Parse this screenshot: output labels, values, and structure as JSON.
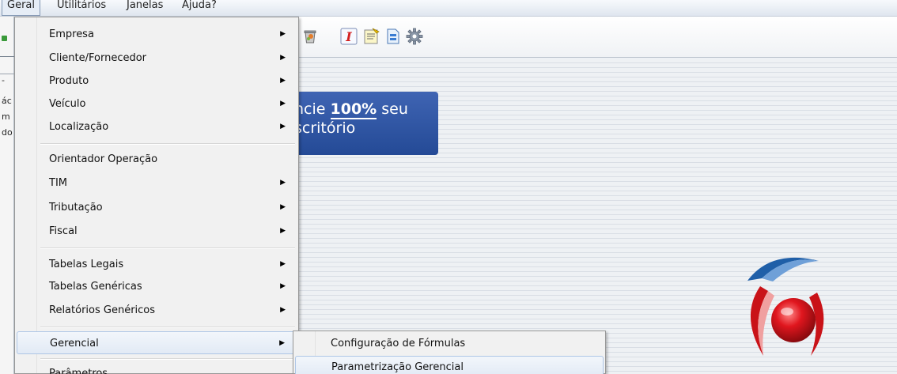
{
  "menubar": {
    "items": [
      "Geral",
      "Utilitários",
      "Janelas",
      "Ajuda?"
    ]
  },
  "left_strip": {
    "fragments": [
      "-",
      "ác",
      "m",
      "do"
    ]
  },
  "toolbar": {
    "icons": [
      "trash-icon",
      "italic-i-icon",
      "notes-icon",
      "document-icon",
      "gear-icon"
    ]
  },
  "banner": {
    "line1_a": "ncie ",
    "line1_b": "100%",
    "line1_c": "  seu",
    "line2": "scritório"
  },
  "menu": {
    "items": [
      {
        "label": "Empresa",
        "has_submenu": true
      },
      {
        "label": "Cliente/Fornecedor",
        "has_submenu": true
      },
      {
        "label": "Produto",
        "has_submenu": true
      },
      {
        "label": "Veículo",
        "has_submenu": true
      },
      {
        "label": "Localização",
        "has_submenu": true
      },
      {
        "label": "Orientador Operação",
        "has_submenu": false
      },
      {
        "label": "TIM",
        "has_submenu": true
      },
      {
        "label": "Tributação",
        "has_submenu": true
      },
      {
        "label": "Fiscal",
        "has_submenu": true
      },
      {
        "label": "Tabelas Legais",
        "has_submenu": true
      },
      {
        "label": "Tabelas Genéricas",
        "has_submenu": true
      },
      {
        "label": "Relatórios Genéricos",
        "has_submenu": true
      },
      {
        "label": "Gerencial",
        "has_submenu": true,
        "highlighted": true
      },
      {
        "label": "Parâmetros",
        "has_submenu": false
      }
    ]
  },
  "submenu": {
    "items": [
      {
        "label": "Configuração de Fórmulas"
      },
      {
        "label": "Parametrização Gerencial",
        "highlighted": true
      }
    ]
  },
  "colors": {
    "banner_blue": "#2f56a6",
    "highlight_border": "#aec6e6",
    "logo_red": "#d8141c",
    "logo_blue": "#1f5fa8"
  }
}
